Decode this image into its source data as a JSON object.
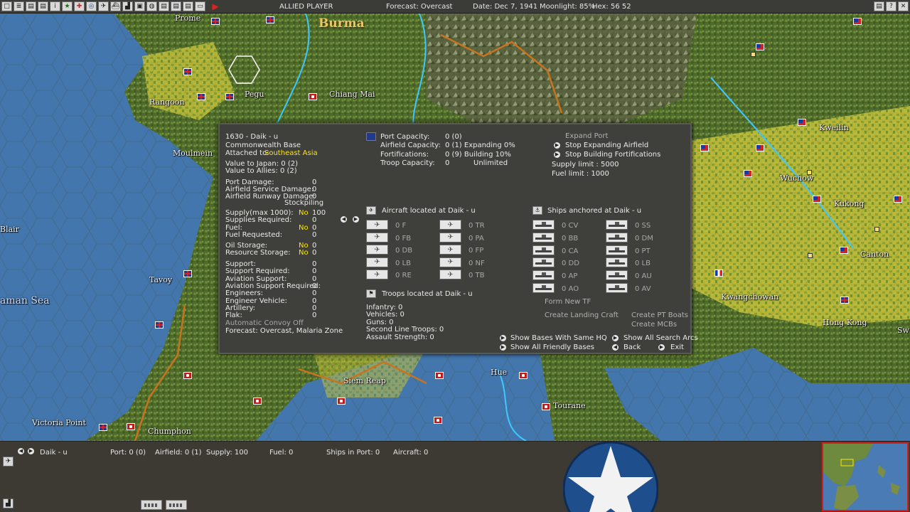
{
  "topbar": {
    "player": "ALLIED PLAYER",
    "forecast": "Forecast: Overcast",
    "date": "Date: Dec 7, 1941",
    "moonlight": "Moonlight: 85%",
    "hex": "Hex: 56 52",
    "icons": [
      "square-icon",
      "list-icon",
      "report-icon",
      "report-icon",
      "info-icon",
      "star-icon",
      "cross-icon",
      "target-icon",
      "aircraft-icon",
      "ship-icon",
      "unit-icon",
      "base-icon",
      "globe-icon",
      "report-icon",
      "report-icon",
      "report-icon",
      "screen-icon"
    ]
  },
  "map": {
    "region_label": "Burma",
    "towns": [
      "Prome",
      "Rangoon",
      "Pegu",
      "Moulmein",
      "Chiang Mai",
      "Blair",
      "Tavoy",
      "aman Sea",
      "Victoria Point",
      "Chumphon",
      "Siem Reap",
      "Hue",
      "Tourane",
      "Kweilin",
      "Wuchow",
      "Kukong",
      "Kwangchowan",
      "Canton",
      "Hong Kong",
      "Sw"
    ]
  },
  "base": {
    "title": "1630 - Daik - u",
    "type": "Commonwealth Base",
    "attached_label": "Attached to:",
    "attached_value": "Southeast Asia",
    "value_japan": "Value to Japan:  0 (2)",
    "value_allies": "Value to Allies:  0 (2)",
    "damage": [
      {
        "label": "Port Damage:",
        "value": "0"
      },
      {
        "label": "Airfield Service Damage:",
        "value": "0"
      },
      {
        "label": "Airfield Runway Damage:",
        "value": "0"
      }
    ],
    "stockpiling": "Stockpiling",
    "supply": [
      {
        "label": "Supply(max 1000):",
        "flag": "No",
        "value": "100"
      },
      {
        "label": "Supplies Required:",
        "flag": "",
        "value": "0"
      },
      {
        "label": "Fuel:",
        "flag": "No",
        "value": "0"
      },
      {
        "label": "Fuel Requested:",
        "flag": "",
        "value": "0"
      },
      {
        "label": "Oil Storage:",
        "flag": "No",
        "value": "0"
      },
      {
        "label": "Resource Storage:",
        "flag": "No",
        "value": "0"
      }
    ],
    "support": [
      {
        "label": "Support:",
        "value": "0"
      },
      {
        "label": "Support Required:",
        "value": "0"
      },
      {
        "label": "Aviation Support:",
        "value": "0"
      },
      {
        "label": "Aviation Support Required:",
        "value": "0"
      },
      {
        "label": "Engineers:",
        "value": "0"
      },
      {
        "label": "Engineer Vehicle:",
        "value": "0"
      },
      {
        "label": "Artillery:",
        "value": "0"
      },
      {
        "label": "Flak:",
        "value": "0"
      }
    ],
    "convoy": "Automatic Convoy Off",
    "forecast": "Forecast: Overcast, Malaria Zone",
    "capacity": [
      {
        "label": "Port Capacity:",
        "value": "0 (0)",
        "extra": ""
      },
      {
        "label": "Airfield Capacity:",
        "value": "0 (1) Expanding 0%",
        "extra": ""
      },
      {
        "label": "Fortifications:",
        "value": "0 (9) Building 10%",
        "extra": ""
      },
      {
        "label": "Troop Capacity:",
        "value": "0",
        "extra": "Unlimited"
      }
    ],
    "actions": {
      "expand_port": "Expand Port",
      "stop_expanding": "Stop Expanding Airfield",
      "stop_building": "Stop Building Fortifications",
      "supply_limit": "Supply limit : 5000",
      "fuel_limit": "Fuel limit : 1000"
    },
    "aircraft_header": "Aircraft located at Daik - u",
    "aircraft_left": [
      "0 F",
      "0 FB",
      "0 DB",
      "0 LB",
      "0 RE"
    ],
    "aircraft_right": [
      "0 TR",
      "0 PA",
      "0 FP",
      "0 NF",
      "0 TB"
    ],
    "ships_header": "Ships anchored at Daik - u",
    "ships_left": [
      "0 CV",
      "0 BB",
      "0 CA",
      "0 DD",
      "0 AP",
      "0 AO"
    ],
    "ships_right": [
      "0 SS",
      "0 DM",
      "0 PT",
      "0 LB",
      "0 AU",
      "0 AV"
    ],
    "troops_header": "Troops located at Daik - u",
    "troops": [
      "Infantry: 0",
      "Vehicles: 0",
      "Guns: 0",
      "Second Line Troops: 0",
      "Assault Strength: 0"
    ],
    "buttons": {
      "form_tf": "Form New TF",
      "landing_craft": "Create Landing Craft",
      "pt_boats": "Create PT Boats",
      "mcbs": "Create MCBs",
      "same_hq": "Show Bases With Same HQ",
      "search_arcs": "Show All Search Arcs",
      "friendly_bases": "Show All Friendly Bases",
      "back": "Back",
      "exit": "Exit"
    }
  },
  "bottombar": {
    "base_name": "Daik - u",
    "port": "Port: 0 (0)",
    "airfield": "Airfield: 0 (1)",
    "supply": "Supply: 100",
    "fuel": "Fuel: 0",
    "ships": "Ships in Port: 0",
    "aircraft": "Aircraft: 0"
  }
}
